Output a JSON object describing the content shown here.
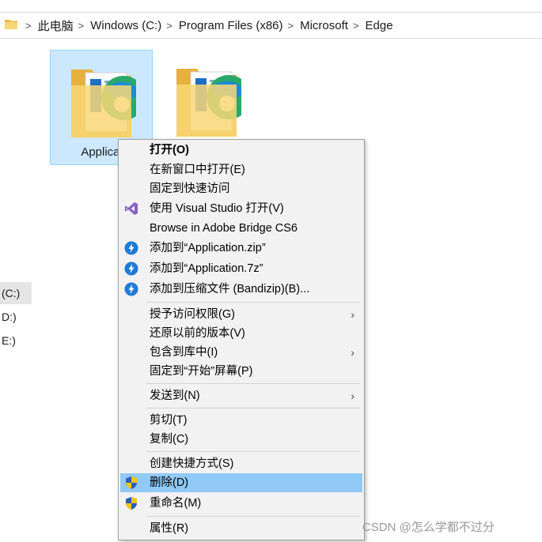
{
  "address": {
    "crumbs": [
      "此电脑",
      "Windows (C:)",
      "Program Files (x86)",
      "Microsoft",
      "Edge"
    ]
  },
  "nav": {
    "items": [
      {
        "label": "(C:)",
        "selected": true
      },
      {
        "label": "D:)",
        "selected": false
      },
      {
        "label": "E:)",
        "selected": false
      }
    ]
  },
  "files": [
    {
      "label": "Applicat",
      "selected": true
    },
    {
      "label": "",
      "selected": false
    }
  ],
  "menu": {
    "items": {
      "open": {
        "label": "打开(O)"
      },
      "open_new_window": {
        "label": "在新窗口中打开(E)"
      },
      "pin_quick_access": {
        "label": "固定到快速访问"
      },
      "open_visual_studio": {
        "label": "使用 Visual Studio 打开(V)",
        "icon": "visual-studio-icon"
      },
      "browse_bridge": {
        "label": "Browse in Adobe Bridge CS6"
      },
      "add_zip": {
        "label": "添加到“Application.zip”",
        "icon": "bandizip-icon"
      },
      "add_7z": {
        "label": "添加到“Application.7z”",
        "icon": "bandizip-icon"
      },
      "add_archive": {
        "label": "添加到压缩文件 (Bandizip)(B)...",
        "icon": "bandizip-icon"
      },
      "grant_access": {
        "label": "授予访问权限(G)"
      },
      "restore_versions": {
        "label": "还原以前的版本(V)"
      },
      "include_library": {
        "label": "包含到库中(I)"
      },
      "pin_start": {
        "label": "固定到“开始”屏幕(P)"
      },
      "send_to": {
        "label": "发送到(N)"
      },
      "cut": {
        "label": "剪切(T)"
      },
      "copy": {
        "label": "复制(C)"
      },
      "create_shortcut": {
        "label": "创建快捷方式(S)"
      },
      "delete": {
        "label": "删除(D)",
        "icon": "uac-shield-icon",
        "highlighted": true
      },
      "rename": {
        "label": "重命名(M)",
        "icon": "uac-shield-icon"
      },
      "properties": {
        "label": "属性(R)"
      }
    },
    "submenu_arrow": "›"
  },
  "watermark": "CSDN @怎么学都不过分",
  "colors": {
    "selection": "#cce8ff",
    "menu_highlight": "#91c9f7",
    "menu_bg": "#f2f2f2",
    "bandizip_blue": "#1e7ad4",
    "vs_purple": "#865fc5"
  }
}
